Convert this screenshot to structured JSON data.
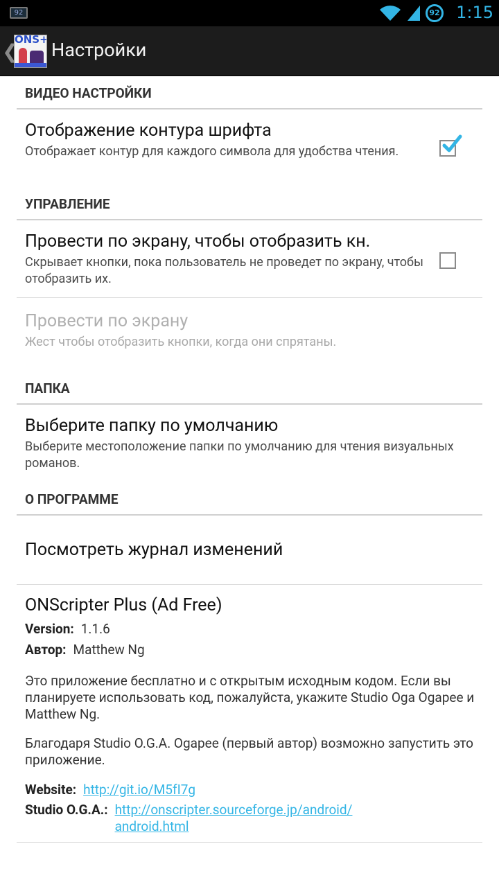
{
  "status_bar": {
    "notification_badge": "92",
    "battery_level": "92",
    "time": "1:15",
    "icons": [
      "wifi-icon",
      "signal-icon",
      "battery-icon"
    ]
  },
  "action_bar": {
    "back_glyph": "❮",
    "logo_text": "ONS+",
    "title": "Настройки"
  },
  "sections": {
    "video": {
      "header": "ВИДЕО НАСТРОЙКИ",
      "outline": {
        "title": "Отображение контура шрифта",
        "summary": "Отображает контур для каждого символа для удобства чтения.",
        "checked": true
      }
    },
    "control": {
      "header": "УПРАВЛЕНИЕ",
      "swipe_show": {
        "title": "Провести по экрану, чтобы отобразить кн.",
        "summary": "Скрывает кнопки, пока пользователь не проведет по экрану, чтобы отобразить их.",
        "checked": false
      },
      "swipe_gesture": {
        "title": "Провести по экрану",
        "summary": "Жест чтобы отобразить кнопки, когда они спрятаны.",
        "enabled": false
      }
    },
    "folder": {
      "header": "ПАПКА",
      "default_folder": {
        "title": "Выберите папку по умолчанию",
        "summary": "Выберите местоположение папки по умолчанию для чтения визуальных романов."
      }
    },
    "about": {
      "header": "О ПРОГРАММЕ",
      "changelog": {
        "title": "Посмотреть журнал изменений"
      },
      "app": {
        "name": "ONScripter Plus (Ad Free)",
        "version_label": "Version:",
        "version_value": "1.1.6",
        "author_label": "Автор:",
        "author_value": "Matthew Ng",
        "paragraph1": "Это приложение бесплатно и с открытым исходным кодом. Если вы планируете использовать код, пожалуйста, укажите Studio Oga Ogapee и Matthew Ng.",
        "paragraph2": "Благодаря Studio O.G.A. Ogapee (первый автор) возможно запустить это приложение.",
        "website_label": "Website:",
        "website_url": "http://git.io/M5fI7g",
        "studio_label": "Studio O.G.A.:",
        "studio_url_line1": "http://onscripter.sourceforge.jp/android/",
        "studio_url_line2": "android.html"
      }
    }
  },
  "colors": {
    "accent": "#33b5e5",
    "action_bar": "#1c1c1c",
    "status_bar": "#000000"
  }
}
